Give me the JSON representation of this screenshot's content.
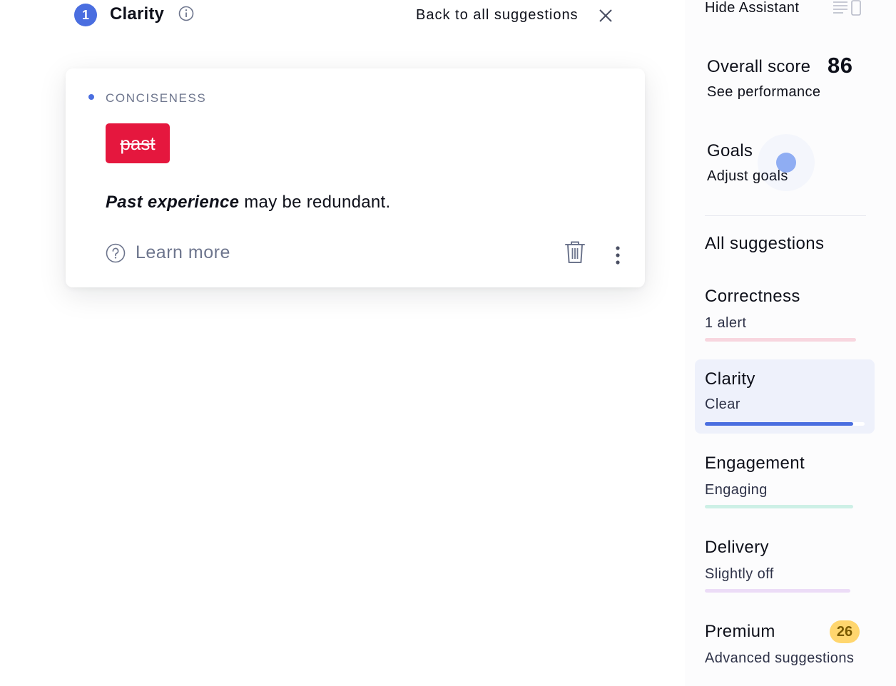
{
  "header": {
    "count": "1",
    "title": "Clarity",
    "back_label": "Back to all suggestions"
  },
  "card": {
    "category": "CONCISENESS",
    "strike_word": "past",
    "explanation_bold": "Past experience",
    "explanation_rest": " may be redundant.",
    "learn_more": "Learn more"
  },
  "sidebar": {
    "hide_assistant": "Hide Assistant",
    "score_label": "Overall score",
    "score_value": "86",
    "see_performance": "See performance",
    "goals_label": "Goals",
    "adjust_goals": "Adjust goals",
    "all_suggestions": "All suggestions",
    "categories": [
      {
        "name": "Correctness",
        "sub": "1 alert",
        "color": "#f8d6df",
        "fill": 1.0
      },
      {
        "name": "Clarity",
        "sub": "Clear",
        "color": "#4a6ee0",
        "fill": 0.93,
        "active": true
      },
      {
        "name": "Engagement",
        "sub": "Engaging",
        "color": "#cdf0e6",
        "fill": 1.0
      },
      {
        "name": "Delivery",
        "sub": "Slightly off",
        "color": "#ecdcf7",
        "fill": 1.0
      }
    ],
    "premium": {
      "name": "Premium",
      "count": "26",
      "sub": "Advanced suggestions"
    }
  },
  "colors": {
    "accent": "#4a6ee0",
    "alert_red": "#e5173e",
    "premium_yellow": "#ffd66e"
  },
  "icons": [
    "info-icon",
    "close-icon",
    "help-icon",
    "trash-icon",
    "more-vertical-icon",
    "panel-toggle-icon"
  ]
}
